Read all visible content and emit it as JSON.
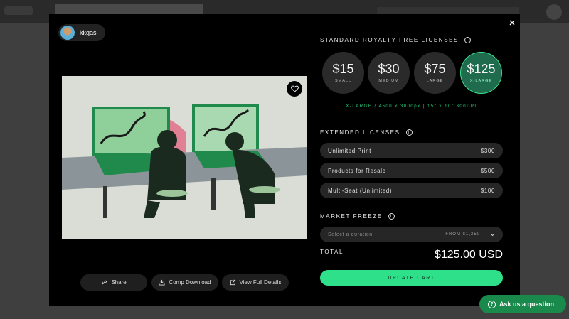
{
  "user": {
    "name": "kkgas"
  },
  "actions": {
    "share": "Share",
    "comp_download": "Comp Download",
    "view_details": "View Full Details"
  },
  "standard": {
    "title": "STANDARD ROYALTY FREE LICENSES",
    "sizes": [
      {
        "price": "$15",
        "label": "SMALL"
      },
      {
        "price": "$30",
        "label": "MEDIUM"
      },
      {
        "price": "$75",
        "label": "LARGE"
      },
      {
        "price": "$125",
        "label": "X-LARGE",
        "selected": true
      }
    ],
    "dimensions": "X-LARGE / 4500 x 3000px | 15\" x 10\" 300DPI"
  },
  "extended": {
    "title": "EXTENDED LICENSES",
    "items": [
      {
        "label": "Unlimited Print",
        "price": "$300"
      },
      {
        "label": "Products for Resale",
        "price": "$500"
      },
      {
        "label": "Multi-Seat (Unlimited)",
        "price": "$100"
      }
    ]
  },
  "freeze": {
    "title": "MARKET FREEZE",
    "placeholder": "Select a duration",
    "from": "FROM $1,250"
  },
  "total": {
    "label": "TOTAL",
    "value": "$125.00 USD"
  },
  "update_label": "UPDATE CART",
  "help_label": "Ask us a question",
  "colors": {
    "accent": "#2fe08a",
    "selected_fill": "#1e6b4e",
    "help_bg": "#1a8a4c",
    "modal_bg": "#000000"
  },
  "icons": [
    "close-icon",
    "heart-icon",
    "share-icon",
    "download-icon",
    "external-link-icon",
    "info-icon",
    "chevron-down-icon",
    "help-icon"
  ]
}
